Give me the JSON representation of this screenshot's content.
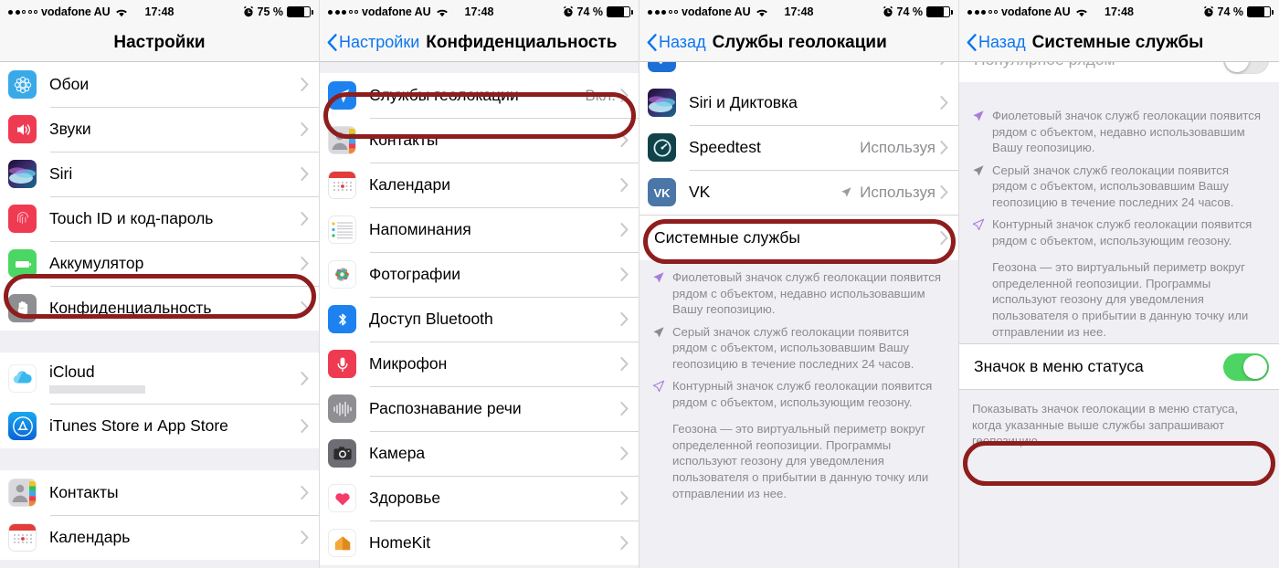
{
  "status_bar": {
    "carrier": "vodafone AU",
    "time": "17:48",
    "battery_1": "75 %",
    "battery_2": "74 %",
    "battery_3": "74 %",
    "battery_4": "74 %",
    "signal_dots_filled_1": 2,
    "signal_dots_filled_2": 3
  },
  "screen1": {
    "title": "Настройки",
    "items_group1": [
      {
        "label": "Обои",
        "icon": "wallpaper-icon"
      },
      {
        "label": "Звуки",
        "icon": "sounds-icon"
      },
      {
        "label": "Siri",
        "icon": "siri-icon"
      },
      {
        "label": "Touch ID и код-пароль",
        "icon": "touchid-icon"
      },
      {
        "label": "Аккумулятор",
        "icon": "battery-icon"
      },
      {
        "label": "Конфиденциальность",
        "icon": "privacy-hand-icon",
        "highlighted": true
      }
    ],
    "items_group2": [
      {
        "label": "iCloud",
        "icon": "icloud-icon"
      },
      {
        "label": "iTunes Store и App Store",
        "icon": "appstore-icon"
      }
    ],
    "items_group3": [
      {
        "label": "Контакты",
        "icon": "contacts-icon"
      },
      {
        "label": "Календарь",
        "icon": "calendar-icon"
      }
    ]
  },
  "screen2": {
    "back_label": "Настройки",
    "title": "Конфиденциальность",
    "items": [
      {
        "label": "Службы геолокации",
        "value": "Вкл.",
        "icon": "location-arrow-icon",
        "highlighted": true
      },
      {
        "label": "Контакты",
        "icon": "contacts-icon"
      },
      {
        "label": "Календари",
        "icon": "calendar-icon"
      },
      {
        "label": "Напоминания",
        "icon": "reminders-icon"
      },
      {
        "label": "Фотографии",
        "icon": "photos-icon"
      },
      {
        "label": "Доступ Bluetooth",
        "icon": "bluetooth-icon"
      },
      {
        "label": "Микрофон",
        "icon": "microphone-icon"
      },
      {
        "label": "Распознавание речи",
        "icon": "speech-icon"
      },
      {
        "label": "Камера",
        "icon": "camera-icon"
      },
      {
        "label": "Здоровье",
        "icon": "health-icon"
      },
      {
        "label": "HomeKit",
        "icon": "homekit-icon"
      }
    ]
  },
  "screen3": {
    "back_label": "Назад",
    "title": "Службы геолокации",
    "items": [
      {
        "label": "Siri и Диктовка",
        "icon": "siri-icon"
      },
      {
        "label": "Speedtest",
        "value": "Используя",
        "icon": "speedtest-icon"
      },
      {
        "label": "VK",
        "value": "Используя",
        "value_arrow": true,
        "icon": "vk-icon"
      }
    ],
    "system_services_label": "Системные службы",
    "system_services_highlighted": true,
    "footnotes": [
      {
        "icon": "purple-filled-arrow-icon",
        "text": "Фиолетовый значок служб геолокации появится рядом с объектом, недавно использовавшим Вашу геопозицию."
      },
      {
        "icon": "gray-filled-arrow-icon",
        "text": "Серый значок служб геолокации появится рядом с объектом, использовавшим Вашу геопозицию в течение последних 24 часов."
      },
      {
        "icon": "purple-outline-arrow-icon",
        "text": "Контурный значок служб геолокации появится рядом с объектом, использующим геозону."
      }
    ],
    "footnote_paragraph": "Геозона — это виртуальный периметр вокруг определенной геопозиции. Программы используют геозону для уведомления пользователя о прибытии в данную точку или отправлении из нее."
  },
  "screen4": {
    "back_label": "Назад",
    "title": "Системные службы",
    "cut_row_label": "Популярное рядом",
    "cut_row_toggle": "off",
    "footnotes": [
      {
        "icon": "purple-filled-arrow-icon",
        "text": "Фиолетовый значок служб геолокации появится рядом с объектом, недавно использовавшим Вашу геопозицию."
      },
      {
        "icon": "gray-filled-arrow-icon",
        "text": "Серый значок служб геолокации появится рядом с объектом, использовавшим Вашу геопозицию в течение последних 24 часов."
      },
      {
        "icon": "purple-outline-arrow-icon",
        "text": "Контурный значок служб геолокации появится рядом с объектом, использующим геозону."
      }
    ],
    "footnote_paragraph": "Геозона — это виртуальный периметр вокруг определенной геопозиции. Программы используют геозону для уведомления пользователя о прибытии в данную точку или отправлении из нее.",
    "status_icon_row": {
      "label": "Значок в меню статуса",
      "toggle": "on",
      "highlighted": true
    },
    "status_icon_footnote": "Показывать значок геолокации в меню статуса, когда указанные выше службы запрашивают геопозицию."
  },
  "colors": {
    "highlight_red": "#8e1d1d",
    "ios_blue": "#0b76ef",
    "toggle_green": "#4cd562",
    "gray_text": "#8e8e93"
  }
}
